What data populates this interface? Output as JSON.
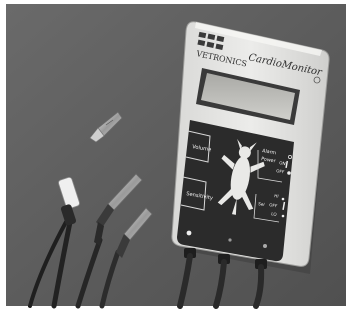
{
  "device": {
    "brand": "VETRONICS",
    "model": "CardioMonitor",
    "controls": {
      "volume_label": "Volume",
      "sensitivity_label": "Sensitivity",
      "alarm_label": "Alarm",
      "power_label": "Power",
      "power_on": "ON",
      "power_off": "OFF",
      "range_hi": "HI",
      "range_sel": "Sel",
      "range_off": "OFF",
      "range_lo": "LO"
    }
  },
  "colors": {
    "background": "#5d5d5d",
    "case": "#e6e6e4",
    "front_panel": "#2b2b2b",
    "lcd": "#bdbdb9",
    "cable": "#2a2a2a"
  },
  "icons": [
    "animal-silhouette-icon",
    "alligator-clip-icon"
  ]
}
